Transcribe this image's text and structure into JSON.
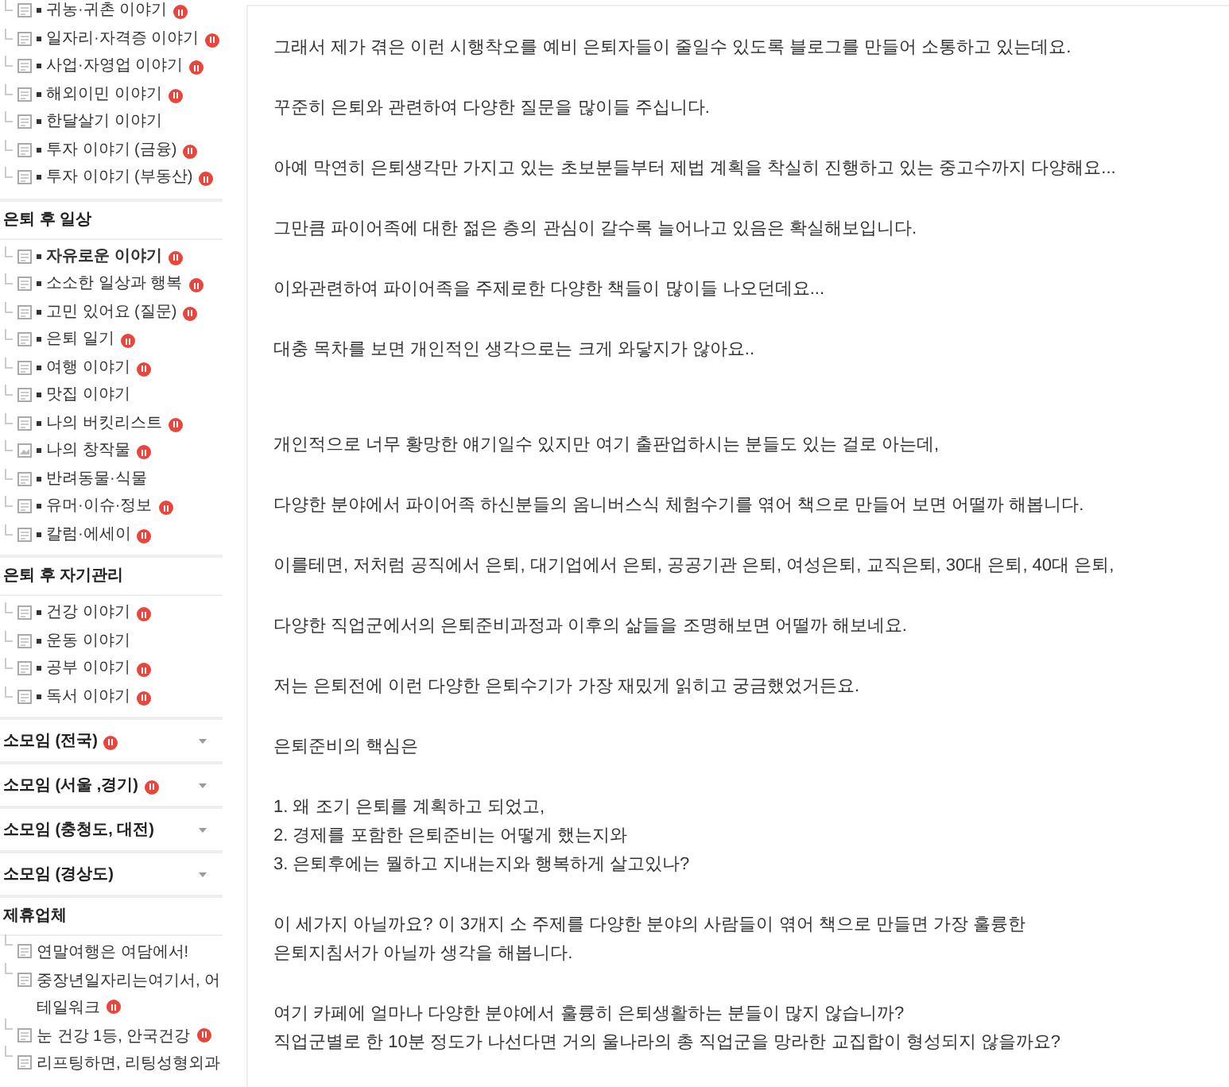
{
  "sidebar": {
    "sections": [
      {
        "kind": "list",
        "items": [
          {
            "label": "귀농·귀촌 이야기",
            "new": true,
            "bold": false,
            "kind": "post"
          },
          {
            "label": "일자리·자격증 이야기",
            "new": true,
            "bold": false,
            "kind": "post"
          },
          {
            "label": "사업·자영업 이야기",
            "new": true,
            "bold": false,
            "kind": "post"
          },
          {
            "label": "해외이민 이야기",
            "new": true,
            "bold": false,
            "kind": "post"
          },
          {
            "label": "한달살기 이야기",
            "new": false,
            "bold": false,
            "kind": "post"
          },
          {
            "label": "투자 이야기 (금융)",
            "new": true,
            "bold": false,
            "kind": "post"
          },
          {
            "label": "투자 이야기 (부동산)",
            "new": true,
            "bold": false,
            "kind": "post"
          }
        ]
      },
      {
        "kind": "group",
        "title": "은퇴 후 일상",
        "items": [
          {
            "label": "자유로운 이야기",
            "new": true,
            "bold": true,
            "kind": "post"
          },
          {
            "label": "소소한 일상과 행복",
            "new": true,
            "bold": false,
            "kind": "post"
          },
          {
            "label": "고민 있어요 (질문)",
            "new": true,
            "bold": false,
            "kind": "post"
          },
          {
            "label": "은퇴 일기",
            "new": true,
            "bold": false,
            "kind": "post"
          },
          {
            "label": "여행 이야기",
            "new": true,
            "bold": false,
            "kind": "post"
          },
          {
            "label": "맛집 이야기",
            "new": false,
            "bold": false,
            "kind": "post"
          },
          {
            "label": "나의 버킷리스트",
            "new": true,
            "bold": false,
            "kind": "post"
          },
          {
            "label": "나의 창작물",
            "new": true,
            "bold": false,
            "kind": "image"
          },
          {
            "label": "반려동물·식물",
            "new": false,
            "bold": false,
            "kind": "post"
          },
          {
            "label": "유머·이슈·정보",
            "new": true,
            "bold": false,
            "kind": "post"
          },
          {
            "label": "칼럼·에세이",
            "new": true,
            "bold": false,
            "kind": "post"
          }
        ]
      },
      {
        "kind": "group",
        "title": "은퇴 후 자기관리",
        "items": [
          {
            "label": "건강 이야기",
            "new": true,
            "bold": false,
            "kind": "post"
          },
          {
            "label": "운동 이야기",
            "new": false,
            "bold": false,
            "kind": "post"
          },
          {
            "label": "공부 이야기",
            "new": true,
            "bold": false,
            "kind": "post"
          },
          {
            "label": "독서 이야기",
            "new": true,
            "bold": false,
            "kind": "post"
          }
        ]
      },
      {
        "kind": "collapsed",
        "title": "소모임 (전국)",
        "new": true
      },
      {
        "kind": "collapsed",
        "title": "소모임 (서울 ,경기)",
        "new": true
      },
      {
        "kind": "collapsed",
        "title": "소모임 (충청도, 대전)",
        "new": false
      },
      {
        "kind": "collapsed",
        "title": "소모임 (경상도)",
        "new": false
      },
      {
        "kind": "links",
        "title": "제휴업체",
        "items": [
          {
            "label": "연말여행은 여담에서!",
            "new": false
          },
          {
            "label": "중장년일자리는여기서, 어테일워크",
            "new": true
          },
          {
            "label": "눈 건강 1등, 안국건강",
            "new": true
          },
          {
            "label": "리프팅하면, 리팅성형외과",
            "new": false
          }
        ]
      }
    ]
  },
  "article": {
    "blocks": [
      {
        "lines": [
          "그래서 제가 겪은 이런 시행착오를 예비 은퇴자들이 줄일수 있도록 블로그를 만들어 소통하고 있는데요."
        ]
      },
      {
        "lines": [
          "꾸준히 은퇴와 관련하여 다양한 질문을 많이들 주십니다."
        ]
      },
      {
        "lines": [
          "아예 막연히 은퇴생각만 가지고 있는 초보분들부터 제법 계획을 착실히 진행하고 있는 중고수까지 다양해요..."
        ]
      },
      {
        "lines": [
          "그만큼 파이어족에 대한 젊은 층의 관심이 갈수록 늘어나고 있음은 확실해보입니다."
        ]
      },
      {
        "lines": [
          "이와관련하여 파이어족을 주제로한 다양한 책들이 많이들 나오던데요..."
        ]
      },
      {
        "lines": [
          "대충 목차를 보면 개인적인 생각으로는 크게 와닿지가 않아요.."
        ]
      },
      {
        "lines": [
          "개인적으로 너무 황망한 얘기일수 있지만 여기 출판업하시는 분들도 있는 걸로 아는데,"
        ]
      },
      {
        "lines": [
          "다양한 분야에서 파이어족 하신분들의 옴니버스식 체험수기를 엮어 책으로 만들어 보면 어떨까 해봅니다."
        ]
      },
      {
        "lines": [
          "이를테면, 저처럼 공직에서 은퇴, 대기업에서 은퇴, 공공기관 은퇴, 여성은퇴, 교직은퇴, 30대 은퇴, 40대 은퇴,"
        ]
      },
      {
        "lines": [
          "다양한 직업군에서의 은퇴준비과정과 이후의 삶들을 조명해보면 어떨까 해보네요."
        ]
      },
      {
        "lines": [
          "저는 은퇴전에 이런 다양한 은퇴수기가 가장 재밌게 읽히고 궁금했었거든요."
        ]
      },
      {
        "lines": [
          "은퇴준비의 핵심은"
        ]
      },
      {
        "lines": [
          "1. 왜 조기 은퇴를 계획하고 되었고,",
          "2. 경제를 포함한 은퇴준비는 어떻게 했는지와",
          "3. 은퇴후에는 뭘하고 지내는지와 행복하게 살고있나?"
        ]
      },
      {
        "lines": [
          "이 세가지 아닐까요? 이 3개지 소 주제를 다양한 분야의 사람들이 엮어 책으로 만들면 가장 훌륭한",
          "은퇴지침서가 아닐까 생각을 해봅니다."
        ]
      },
      {
        "lines": [
          "여기 카페에 얼마나 다양한 분야에서 훌륭히 은퇴생활하는 분들이 많지 않습니까?",
          "직업군별로 한 10분 정도가 나선다면 거의 울나라의 총 직업군을 망라한 교집합이 형성되지 않을까요?"
        ]
      }
    ]
  }
}
